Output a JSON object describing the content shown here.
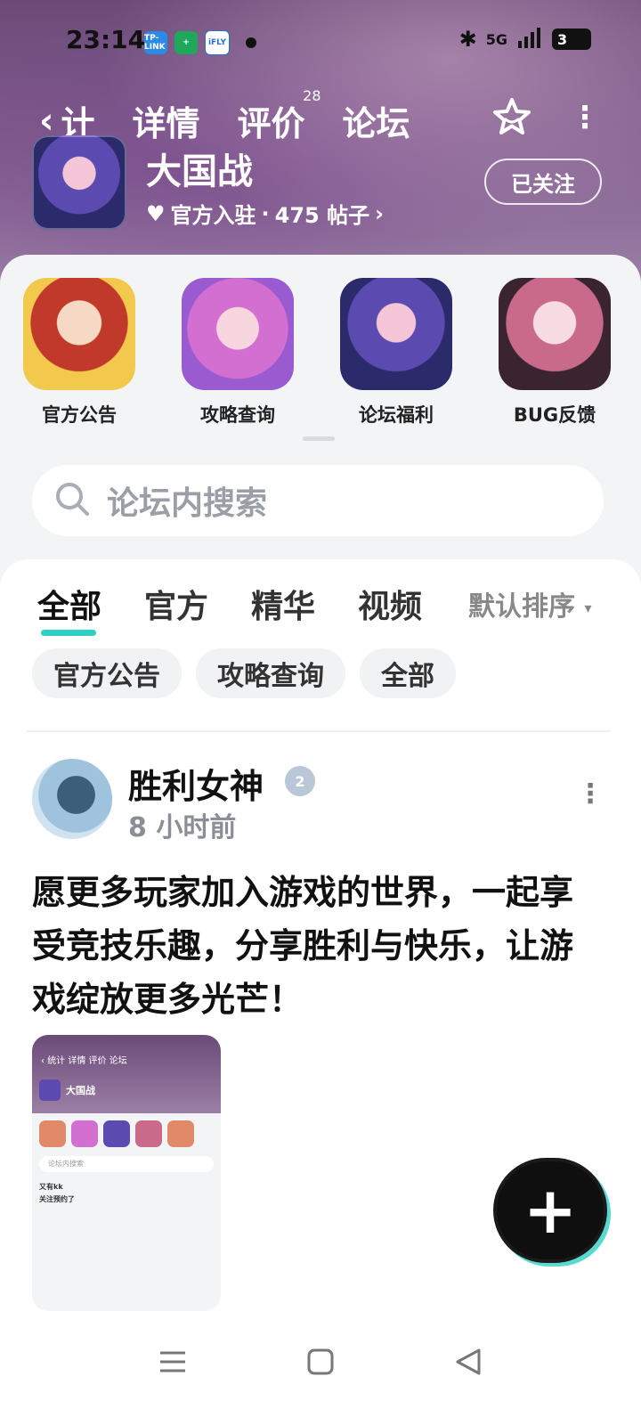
{
  "status_bar": {
    "time": "23:14",
    "app_icons": [
      "tplink-app-icon",
      "battery-saver-icon",
      "ifly-app-icon"
    ],
    "app_icon_labels": [
      "TP-LINK",
      "+",
      "iFLY"
    ],
    "network": "5G",
    "battery": "3"
  },
  "header": {
    "tabs": [
      {
        "label": "计",
        "badge": ""
      },
      {
        "label": "详情",
        "badge": ""
      },
      {
        "label": "评价",
        "badge": "28"
      },
      {
        "label": "论坛",
        "badge": ""
      }
    ],
    "active_tab": "论坛",
    "game_title": "大国战",
    "meta_official": "官方入驻",
    "meta_sep": "·",
    "meta_posts": "475 帖子",
    "meta_chevron": "›",
    "follow_label": "已关注",
    "accent_color": "#2fd0c4"
  },
  "quick_links": [
    {
      "label": "官方公告"
    },
    {
      "label": "攻略查询"
    },
    {
      "label": "论坛福利"
    },
    {
      "label": "BUG反馈"
    }
  ],
  "search": {
    "placeholder": "论坛内搜索"
  },
  "feed_tabs": {
    "tabs": [
      "全部",
      "官方",
      "精华",
      "视频"
    ],
    "active": "全部",
    "sort_label": "默认排序"
  },
  "filter_chips": [
    "官方公告",
    "攻略查询",
    "全部"
  ],
  "post": {
    "author": "胜利女神",
    "level": "2",
    "time": "8 小时前",
    "body": "愿更多玩家加入游戏的世界，一起享受竞技乐趣，分享胜利与快乐，让游戏绽放更多光芒！",
    "more": "⋮",
    "thumbnail": {
      "nav": "‹ 统计  详情  评价  论坛",
      "title": "大国战",
      "search": "论坛内搜索",
      "user": "又有kk",
      "text": "关注预约了"
    }
  },
  "fab": {
    "label": "+"
  }
}
